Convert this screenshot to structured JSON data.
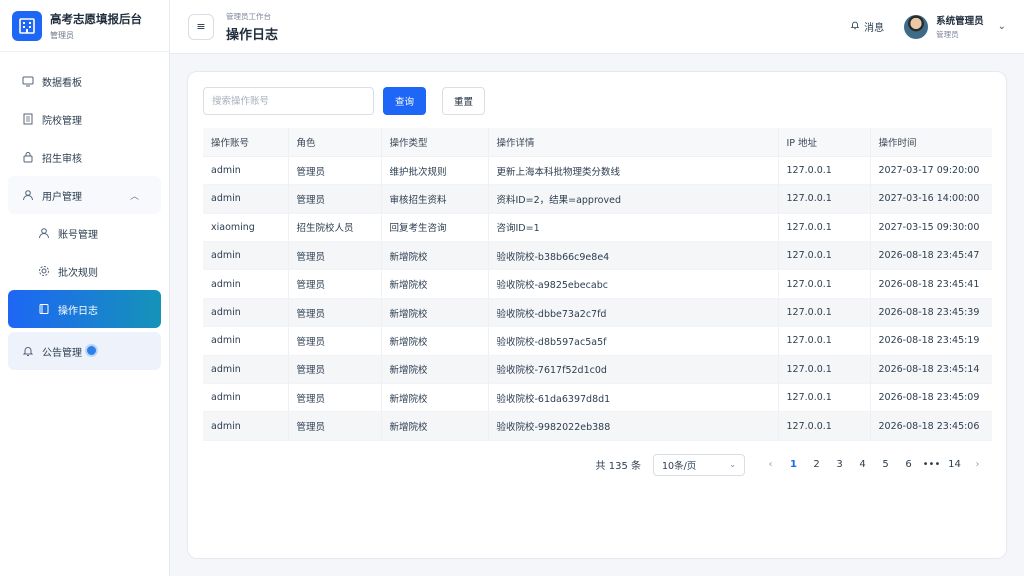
{
  "brand": {
    "title": "高考志愿填报后台",
    "subtitle": "管理员",
    "icon": "building-icon"
  },
  "sidebar": {
    "items": [
      {
        "label": "数据看板",
        "icon": "dashboard-icon"
      },
      {
        "label": "院校管理",
        "icon": "school-icon"
      },
      {
        "label": "招生审核",
        "icon": "lock-icon"
      }
    ],
    "group": {
      "label": "用户管理",
      "icon": "user-icon",
      "chevron": "︿"
    },
    "submenu": [
      {
        "label": "账号管理",
        "icon": "user-icon"
      },
      {
        "label": "批次规则",
        "icon": "gear-icon"
      },
      {
        "label": "操作日志",
        "icon": "book-icon",
        "active": true
      }
    ],
    "notice": {
      "label": "公告管理",
      "icon": "bell-icon"
    }
  },
  "header": {
    "breadcrumb": "管理员工作台",
    "title": "操作日志",
    "messages": "消息",
    "user_name": "系统管理员",
    "user_role": "管理员"
  },
  "search": {
    "placeholder": "搜索操作账号",
    "query_label": "查询",
    "reset_label": "重置"
  },
  "table": {
    "columns": [
      "操作账号",
      "角色",
      "操作类型",
      "操作详情",
      "IP 地址",
      "操作时间"
    ],
    "rows": [
      [
        "admin",
        "管理员",
        "维护批次规则",
        "更新上海本科批物理类分数线",
        "127.0.0.1",
        "2027-03-17 09:20:00"
      ],
      [
        "admin",
        "管理员",
        "审核招生资料",
        "资料ID=2，结果=approved",
        "127.0.0.1",
        "2027-03-16 14:00:00"
      ],
      [
        "xiaoming",
        "招生院校人员",
        "回复考生咨询",
        "咨询ID=1",
        "127.0.0.1",
        "2027-03-15 09:30:00"
      ],
      [
        "admin",
        "管理员",
        "新增院校",
        "验收院校-b38b66c9e8e4",
        "127.0.0.1",
        "2026-08-18 23:45:47"
      ],
      [
        "admin",
        "管理员",
        "新增院校",
        "验收院校-a9825ebecabc",
        "127.0.0.1",
        "2026-08-18 23:45:41"
      ],
      [
        "admin",
        "管理员",
        "新增院校",
        "验收院校-dbbe73a2c7fd",
        "127.0.0.1",
        "2026-08-18 23:45:39"
      ],
      [
        "admin",
        "管理员",
        "新增院校",
        "验收院校-d8b597ac5a5f",
        "127.0.0.1",
        "2026-08-18 23:45:19"
      ],
      [
        "admin",
        "管理员",
        "新增院校",
        "验收院校-7617f52d1c0d",
        "127.0.0.1",
        "2026-08-18 23:45:14"
      ],
      [
        "admin",
        "管理员",
        "新增院校",
        "验收院校-61da6397d8d1",
        "127.0.0.1",
        "2026-08-18 23:45:09"
      ],
      [
        "admin",
        "管理员",
        "新增院校",
        "验收院校-9982022eb388",
        "127.0.0.1",
        "2026-08-18 23:45:06"
      ]
    ]
  },
  "pagination": {
    "total": "共 135 条",
    "page_size": "10条/页",
    "pages": [
      "1",
      "2",
      "3",
      "4",
      "5",
      "6",
      "•••",
      "14"
    ],
    "current": "1",
    "prev": "‹",
    "next": "›"
  },
  "colors": {
    "primary": "#1e66f5",
    "active_gradient_end": "#1593b8"
  }
}
